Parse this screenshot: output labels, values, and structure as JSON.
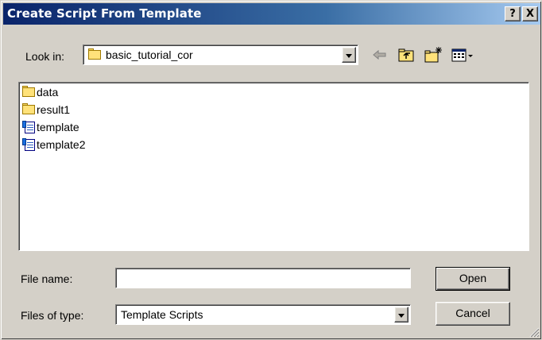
{
  "window": {
    "title": "Create Script From Template",
    "help_label": "?",
    "close_label": "X"
  },
  "lookin": {
    "label": "Look in:",
    "value": "basic_tutorial_cor"
  },
  "toolbar": {
    "icons": [
      "back-arrow-icon",
      "up-folder-icon",
      "new-folder-icon",
      "view-menu-icon"
    ]
  },
  "files": [
    {
      "name": "data",
      "type": "folder"
    },
    {
      "name": "result1",
      "type": "folder"
    },
    {
      "name": "template",
      "type": "script"
    },
    {
      "name": "template2",
      "type": "script"
    }
  ],
  "filename": {
    "label": "File name:",
    "value": ""
  },
  "filetype": {
    "label": "Files of type:",
    "value": "Template Scripts"
  },
  "buttons": {
    "open": "Open",
    "cancel": "Cancel"
  },
  "colors": {
    "title_start": "#0a246a",
    "title_end": "#a6caf0",
    "face": "#d4d0c8"
  }
}
